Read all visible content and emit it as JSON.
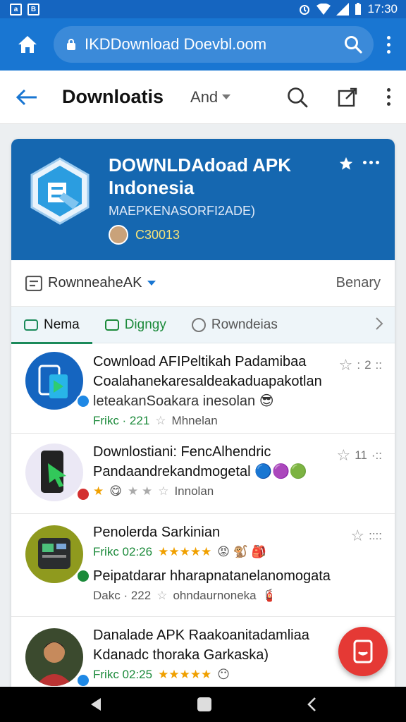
{
  "status_bar": {
    "time": "17:30",
    "icons": [
      "notification-icon",
      "gallery-icon",
      "alarm-icon",
      "wifi-icon",
      "signal-icon",
      "battery-icon"
    ]
  },
  "url_bar": {
    "url": "IKDDownload Doevbl.oom",
    "icons": [
      "home-icon",
      "lock-icon",
      "search-icon",
      "overflow-menu-icon"
    ]
  },
  "toolbar": {
    "title": "Downloatis",
    "language": "And",
    "icons": [
      "back-arrow-icon",
      "search-icon",
      "share-icon",
      "overflow-menu-icon"
    ]
  },
  "app_header": {
    "title": "DOWNLDAdoad APK Indonesia",
    "subtitle": "MAEPKENASORFI2ADE)",
    "meta": "C30013",
    "colors": {
      "banner": "#1567b0",
      "meta_text": "#f4e27a"
    }
  },
  "filter": {
    "label": "RownneaheAK",
    "sort": "Benary"
  },
  "tabs": [
    {
      "label": "Nema",
      "icon": "message-icon",
      "color": "#111111"
    },
    {
      "label": "Digngy",
      "icon": "chat-icon",
      "color": "#1b8a3a"
    },
    {
      "label": "Rowndeias",
      "icon": "clock-icon",
      "color": "#555555"
    }
  ],
  "apps": [
    {
      "title": "Cownload AFIPeltikah Padamibaa",
      "line2": "Coalahanekaresaldeakaduapakotlan",
      "line3": "leteakanSoakara inesolan",
      "info_a": "Frikc · 221",
      "info_b": "Mhnelan",
      "rating": "2",
      "icon": "app-blue-phone-icon"
    },
    {
      "title": "Downlostiani: FencAlhendric",
      "line2": "Pandaandrekandmogetal",
      "info_stars": "★",
      "info_b": "Innolan",
      "rating": "11",
      "icon": "app-phone-cursor-icon"
    },
    {
      "title": "Penolerda Sarkinian",
      "info_a": "Frikc 02:26",
      "info_stars": "★★★★★",
      "line3": "Peipatdarar hharapnatanelanomogata",
      "info_c": "Dakc · 222",
      "info_d": "ohndaurnoneka",
      "icon": "app-green-phone-icon"
    },
    {
      "title": "Danalade APK Raakoanitadamliaa",
      "line2": "Kdanadc thoraka Garkaska)",
      "info_a": "Frikc 02:25",
      "info_stars": "★★★★★",
      "icon": "app-person-avatar-icon"
    }
  ],
  "fab": {
    "icon": "tablet-icon",
    "color": "#e53935"
  },
  "nav": {
    "icons": [
      "back-triangle-icon",
      "home-square-icon",
      "recent-chevron-icon"
    ]
  }
}
